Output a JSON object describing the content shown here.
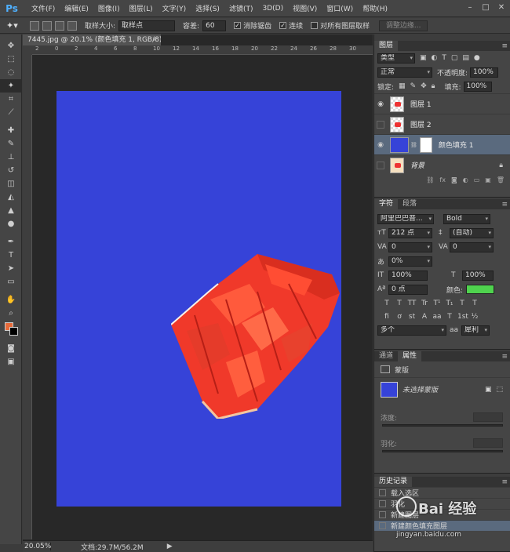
{
  "app": {
    "logo": "Ps"
  },
  "menu": [
    "文件(F)",
    "编辑(E)",
    "图像(I)",
    "图层(L)",
    "文字(Y)",
    "选择(S)",
    "滤镜(T)",
    "3D(D)",
    "视图(V)",
    "窗口(W)",
    "帮助(H)"
  ],
  "options": {
    "sample_size_label": "取样大小:",
    "sample_size_value": "取样点",
    "tolerance_label": "容差:",
    "tolerance_value": "60",
    "antialias_label": "消除锯齿",
    "contiguous_label": "连续",
    "all_layers_label": "对所有图层取样",
    "refine_edge_label": "调整边缘..."
  },
  "document": {
    "tab_title": "7445.jpg @ 20.1% (颜色填充 1, RGB/8) *",
    "ruler_marks": [
      "2",
      "0",
      "2",
      "4",
      "6",
      "8",
      "10",
      "12",
      "14",
      "16",
      "18",
      "20",
      "22",
      "24",
      "26",
      "28",
      "30"
    ],
    "canvas_color": "#3643d8"
  },
  "status": {
    "zoom": "20.05%",
    "doc_info": "文档:29.7M/56.2M"
  },
  "layers_panel": {
    "tab": "图层",
    "kind_filter": "类型",
    "blend_mode": "正常",
    "opacity_label": "不透明度:",
    "opacity_value": "100%",
    "lock_label": "锁定:",
    "fill_label": "填充:",
    "fill_value": "100%",
    "layers": [
      {
        "name": "图层 1",
        "visible": true
      },
      {
        "name": "图层 2",
        "visible": false
      },
      {
        "name": "颜色填充 1",
        "visible": true,
        "selected": true
      },
      {
        "name": "背景",
        "visible": false,
        "locked": true
      }
    ]
  },
  "character_panel": {
    "tabs": [
      "字符",
      "段落"
    ],
    "font_family": "阿里巴巴普...",
    "font_style": "Bold",
    "font_size": "212 点",
    "leading": "(自动)",
    "kerning": "0",
    "tracking": "0",
    "scale_percent": "0%",
    "vertical_scale": "100%",
    "horizontal_scale": "100%",
    "baseline_shift": "0 点",
    "color_label": "颜色:",
    "color_value": "#4fd34e",
    "language": "多个",
    "antialias": "犀利",
    "type_buttons": [
      "T",
      "T",
      "TT",
      "Tr",
      "T¹",
      "T₁",
      "T",
      "T"
    ],
    "ot_buttons": [
      "fi",
      "ơ",
      "st",
      "A",
      "aa",
      "T",
      "1st",
      "½"
    ]
  },
  "properties_panel": {
    "tabs": [
      "通道",
      "属性"
    ],
    "section_title": "蒙版",
    "mask_label": "未选择蒙版",
    "density_label": "浓度:",
    "feather_label": "羽化:"
  },
  "history_panel": {
    "tab": "历史记录",
    "items": [
      "载入选区",
      "羽化",
      "新建图层",
      "新建颜色填充图层"
    ]
  },
  "watermark": {
    "main": "Bai 经验",
    "sub": "jingyan.baidu.com"
  }
}
